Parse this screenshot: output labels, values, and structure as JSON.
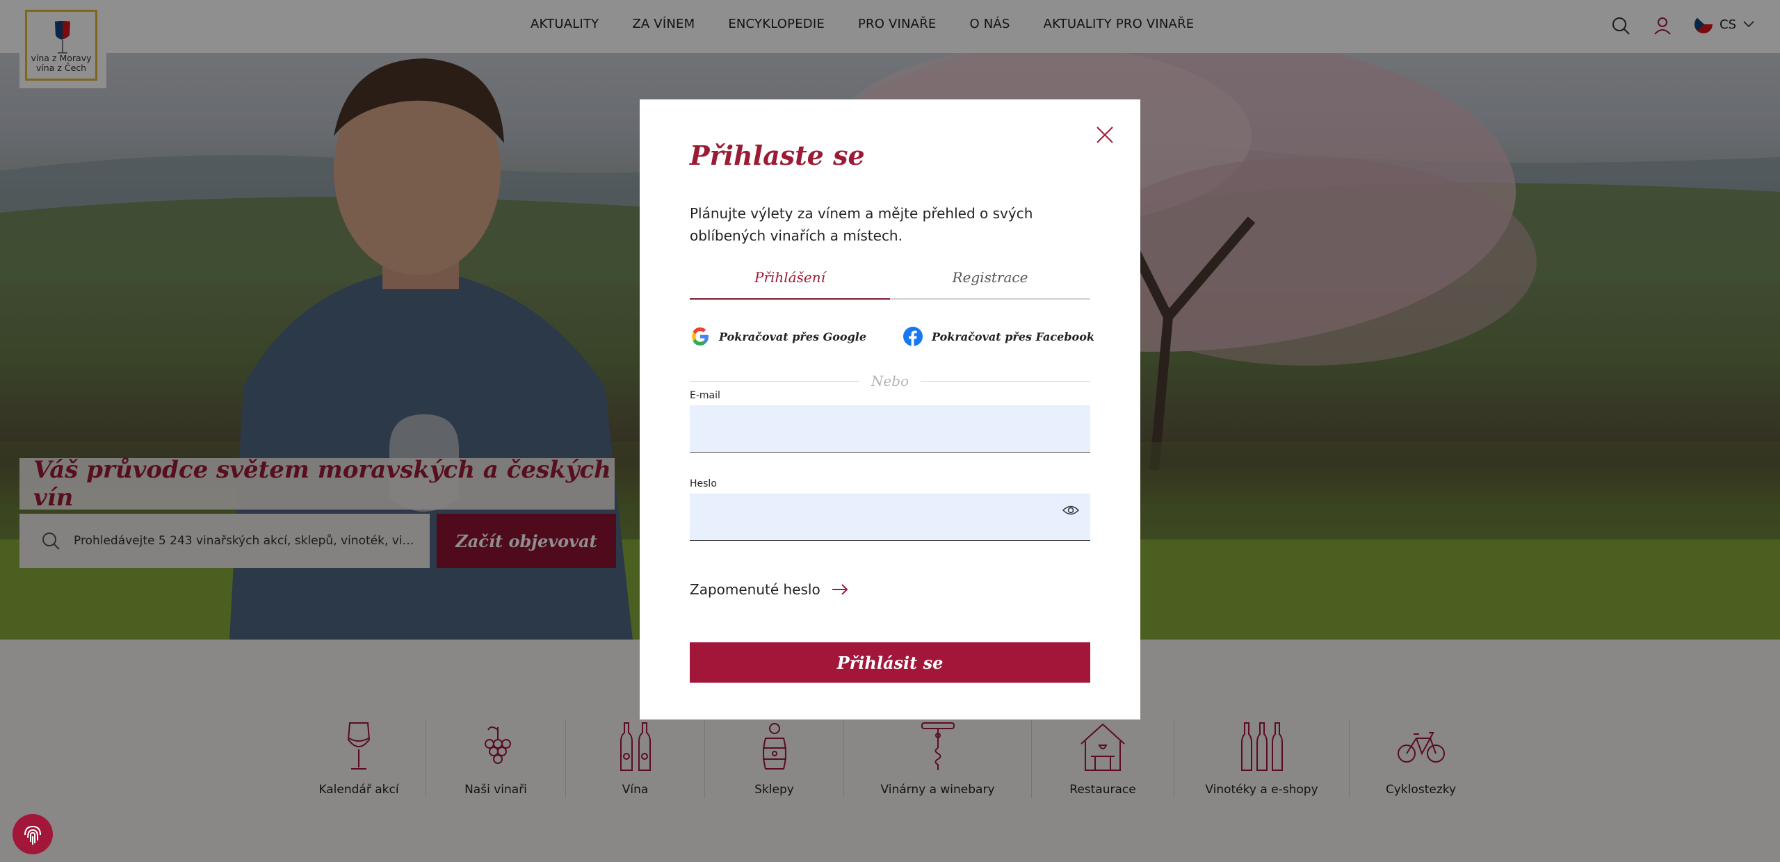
{
  "header": {
    "logo_text": [
      "vína z Moravy",
      "vína z Čech"
    ],
    "nav": [
      "AKTUALITY",
      "ZA VÍNEM",
      "ENCYKLOPEDIE",
      "PRO VINAŘE",
      "O NÁS",
      "AKTUALITY PRO VINAŘE"
    ],
    "language": "CS"
  },
  "hero": {
    "title": "Váš průvodce světem moravských a českých vín",
    "search_placeholder": "Prohledávejte 5 243 vinařských akcí, sklepů, vinoték, vinařů ...",
    "cta_label": "Začít objevovat"
  },
  "categories": [
    {
      "label": "Kalendář akcí",
      "icon": "wine-glass-icon"
    },
    {
      "label": "Naši vinaři",
      "icon": "grapes-icon"
    },
    {
      "label": "Vína",
      "icon": "wine-bottles-icon"
    },
    {
      "label": "Sklepy",
      "icon": "barrel-icon"
    },
    {
      "label": "Vinárny a winebary",
      "icon": "corkscrew-icon"
    },
    {
      "label": "Restaurace",
      "icon": "restaurant-icon"
    },
    {
      "label": "Vinotéky a e-shopy",
      "icon": "shop-bottles-icon"
    },
    {
      "label": "Cyklostezky",
      "icon": "bicycle-icon"
    }
  ],
  "modal": {
    "title": "Přihlaste se",
    "description": "Plánujte výlety za vínem a mějte přehled o svých oblíbených vinařích a místech.",
    "tabs": {
      "login": "Přihlášení",
      "register": "Registrace"
    },
    "google_label": "Pokračovat přes Google",
    "facebook_label": "Pokračovat přes Facebook",
    "divider": "Nebo",
    "email_label": "E-mail",
    "email_value": "",
    "password_label": "Heslo",
    "password_value": "",
    "forgot_label": "Zapomenuté heslo",
    "submit_label": "Přihlásit se"
  },
  "colors": {
    "brand": "#9b1b35",
    "button": "#a2163a",
    "input_bg": "#e8f0fe"
  }
}
